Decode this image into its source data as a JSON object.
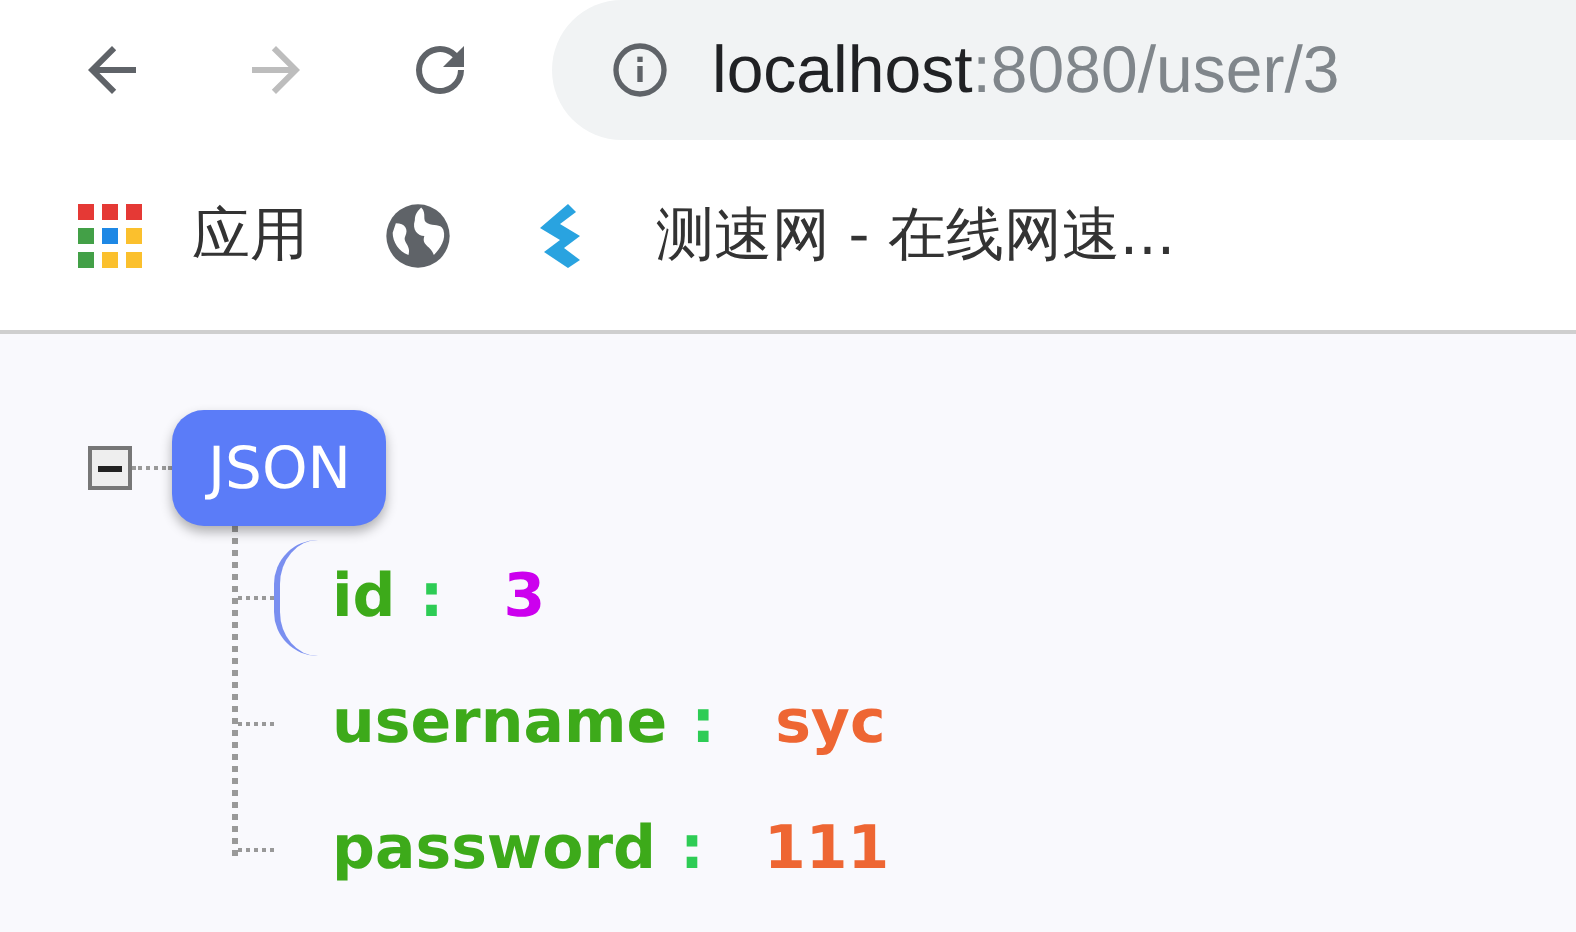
{
  "address_bar": {
    "host": "localhost",
    "path": ":8080/user/3"
  },
  "bookmarks": [
    {
      "kind": "apps",
      "label": "应用"
    },
    {
      "kind": "globe"
    },
    {
      "kind": "site",
      "label": "测速网 - 在线网速..."
    }
  ],
  "tree": {
    "root": {
      "label": "JSON",
      "expanded": true
    },
    "fields": [
      {
        "key": "id",
        "separator": ":",
        "value": "3",
        "kind": "number",
        "selected": true
      },
      {
        "key": "username",
        "separator": ":",
        "value": "syc",
        "kind": "string",
        "selected": false
      },
      {
        "key": "password",
        "separator": ":",
        "value": "111",
        "kind": "string",
        "selected": false
      }
    ]
  }
}
